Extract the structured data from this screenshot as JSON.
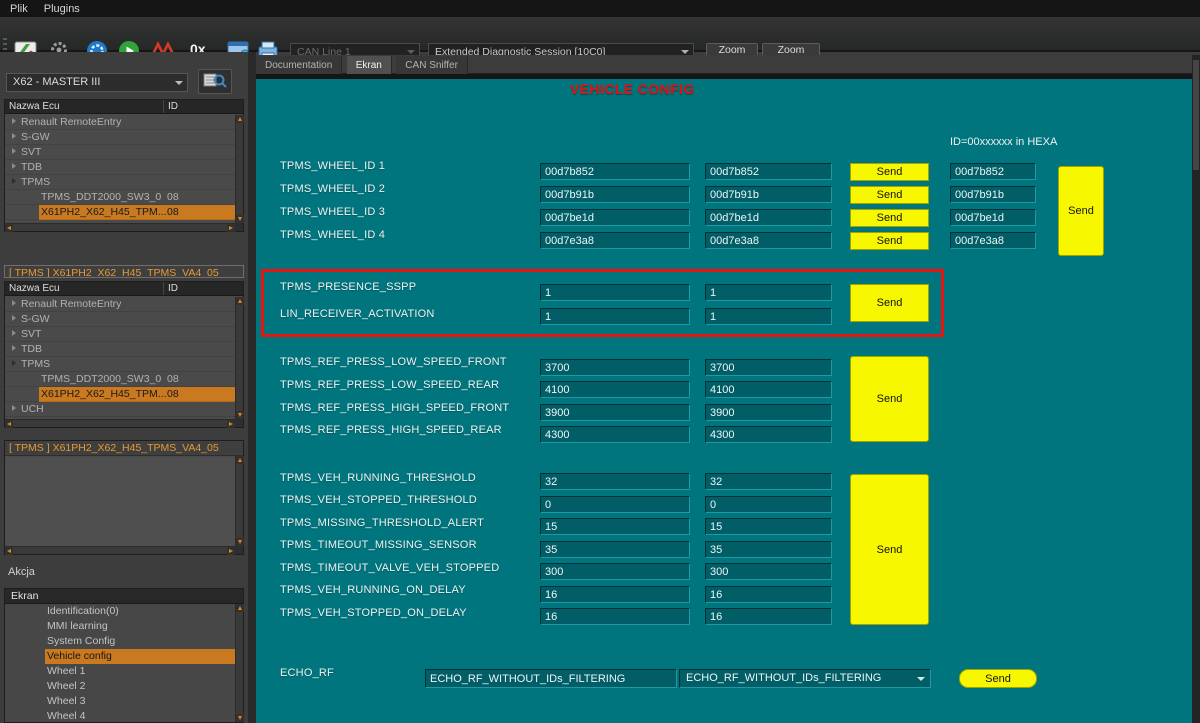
{
  "menu": {
    "items": [
      {
        "label": "Plik"
      },
      {
        "label": "Plugins"
      }
    ]
  },
  "toolbar": {
    "hex_label": "0x",
    "can_line": "CAN Line 1",
    "session": "Extended Diagnostic Session [10C0]",
    "zoom_in": "Zoom In",
    "zoom_out": "Zoom Out"
  },
  "sidebar": {
    "ecu_select": "X62 - MASTER III",
    "panel_title": "[ TPMS ] X61PH2_X62_H45_TPMS_VA4_05",
    "akcja_label": "Akcja",
    "tree": {
      "col_name": "Nazwa Ecu",
      "col_id": "ID",
      "items": [
        {
          "label": "Renault RemoteEntry",
          "id": ""
        },
        {
          "label": "S-GW",
          "id": ""
        },
        {
          "label": "SVT",
          "id": ""
        },
        {
          "label": "TDB",
          "id": ""
        },
        {
          "label": "TPMS",
          "id": ""
        },
        {
          "label": "TPMS_DDT2000_SW3_0",
          "id": "08"
        },
        {
          "label": "X61PH2_X62_H45_TPM...",
          "id": "08"
        },
        {
          "label": "UCH",
          "id": ""
        }
      ]
    },
    "ekran": {
      "header": "Ekran",
      "items": [
        {
          "label": "Identification(0)"
        },
        {
          "label": "MMI learning"
        },
        {
          "label": "System Config"
        },
        {
          "label": "Vehicle config"
        },
        {
          "label": "Wheel 1"
        },
        {
          "label": "Wheel 2"
        },
        {
          "label": "Wheel 3"
        },
        {
          "label": "Wheel 4"
        }
      ]
    }
  },
  "tabs": {
    "items": [
      {
        "label": "Documentation"
      },
      {
        "label": "Ekran"
      },
      {
        "label": "CAN Sniffer"
      }
    ]
  },
  "main": {
    "title": "VEHICLE CONFIG",
    "hexa_note": "ID=00xxxxxx  in HEXA",
    "send": "Send",
    "wheel": {
      "rows": [
        {
          "label": "TPMS_WHEEL_ID 1",
          "v1": "00d7b852",
          "v2": "00d7b852",
          "v3": "00d7b852"
        },
        {
          "label": "TPMS_WHEEL_ID 2",
          "v1": "00d7b91b",
          "v2": "00d7b91b",
          "v3": "00d7b91b"
        },
        {
          "label": "TPMS_WHEEL_ID 3",
          "v1": "00d7be1d",
          "v2": "00d7be1d",
          "v3": "00d7be1d"
        },
        {
          "label": "TPMS_WHEEL_ID 4",
          "v1": "00d7e3a8",
          "v2": "00d7e3a8",
          "v3": "00d7e3a8"
        }
      ]
    },
    "presence": {
      "rows": [
        {
          "label": "TPMS_PRESENCE_SSPP",
          "v1": "1",
          "v2": "1"
        },
        {
          "label": "LIN_RECEIVER_ACTIVATION",
          "v1": "1",
          "v2": "1"
        }
      ]
    },
    "press": {
      "rows": [
        {
          "label": "TPMS_REF_PRESS_LOW_SPEED_FRONT",
          "v1": "3700",
          "v2": "3700"
        },
        {
          "label": "TPMS_REF_PRESS_LOW_SPEED_REAR",
          "v1": "4100",
          "v2": "4100"
        },
        {
          "label": "TPMS_REF_PRESS_HIGH_SPEED_FRONT",
          "v1": "3900",
          "v2": "3900"
        },
        {
          "label": "TPMS_REF_PRESS_HIGH_SPEED_REAR",
          "v1": "4300",
          "v2": "4300"
        }
      ]
    },
    "threshold": {
      "rows": [
        {
          "label": "TPMS_VEH_RUNNING_THRESHOLD",
          "v1": "32",
          "v2": "32"
        },
        {
          "label": "TPMS_VEH_STOPPED_THRESHOLD",
          "v1": "0",
          "v2": "0"
        },
        {
          "label": "TPMS_MISSING_THRESHOLD_ALERT",
          "v1": "15",
          "v2": "15"
        },
        {
          "label": "TPMS_TIMEOUT_MISSING_SENSOR",
          "v1": "35",
          "v2": "35"
        },
        {
          "label": "TPMS_TIMEOUT_VALVE_VEH_STOPPED",
          "v1": "300",
          "v2": "300"
        },
        {
          "label": "TPMS_VEH_RUNNING_ON_DELAY",
          "v1": "16",
          "v2": "16"
        },
        {
          "label": "TPMS_VEH_STOPPED_ON_DELAY",
          "v1": "16",
          "v2": "16"
        }
      ]
    },
    "echo": {
      "label": "ECHO_RF",
      "value": "ECHO_RF_WITHOUT_IDs_FILTERING",
      "selected": "ECHO_RF_WITHOUT_IDs_FILTERING"
    }
  },
  "colors": {
    "teal_bg": "#00757e",
    "send_yellow": "#f7f700",
    "highlight_red": "#e81313",
    "selection_orange": "#c9791f",
    "title_red": "#ea0d0d"
  }
}
